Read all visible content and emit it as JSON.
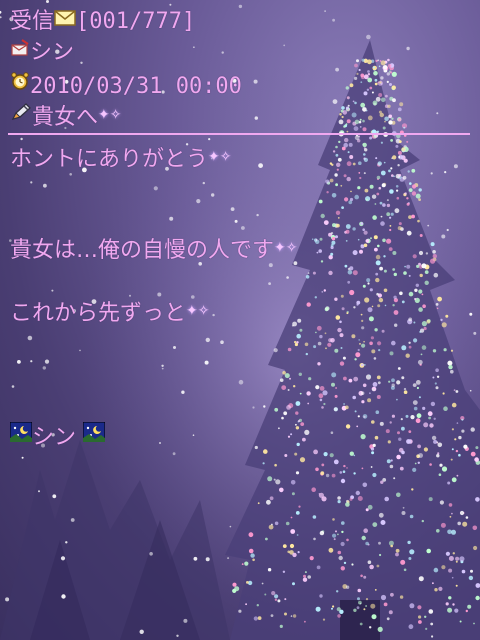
{
  "header": {
    "folder_label": "受信",
    "message_index": "[001/777]",
    "sender_name": "シン",
    "datetime": "2010/03/31 00:00",
    "subject": "貴女へ"
  },
  "body": {
    "line1": "ホントにありがとう",
    "line2": "貴女は…俺の自慢の人です",
    "line3": "これから先ずっと",
    "signature": "シン"
  },
  "icons": {
    "envelope": "envelope-icon",
    "sender": "sender-icon",
    "clock": "alarm-clock-icon",
    "subject": "pen-icon",
    "sparkle": "sparkle-icon",
    "night_sky": "night-sky-icon"
  },
  "colors": {
    "text": "#f0a8f0",
    "background": "#5a4c88"
  }
}
